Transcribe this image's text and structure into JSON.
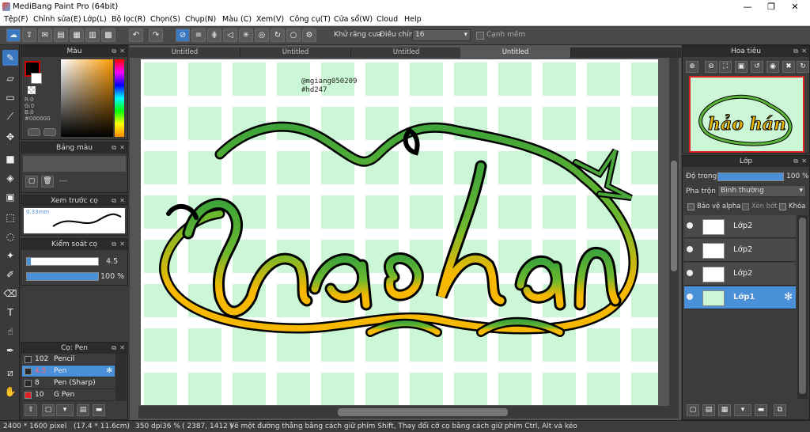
{
  "app": {
    "title": "MediBang Paint Pro (64bit)",
    "min": "—",
    "max": "❐",
    "close": "✕"
  },
  "menu": [
    "Tệp(F)",
    "Chỉnh sửa(E)",
    "Lớp(L)",
    "Bộ lọc(R)",
    "Chọn(S)",
    "Chụp(N)",
    "Màu (C)",
    "Xem(V)",
    "Công cụ(T)",
    "Cửa sổ(W)",
    "Cloud",
    "Help"
  ],
  "toolbar": {
    "antialias_label": "Khử răng cưa",
    "adjust_label": "Điều chỉnh",
    "adjust_value": "16",
    "edge_label": "Cạnh mềm",
    "antialias_checked": "✕"
  },
  "color_panel": {
    "title": "Màu",
    "r": "R:0",
    "g": "G:0",
    "b": "B:0",
    "hex": "#000000",
    "fg": "#000000",
    "accent": "#cc0000"
  },
  "palette_panel": {
    "title": "Bảng màu",
    "value": "---"
  },
  "brush_preview": {
    "title": "Xem trước cọ",
    "size": "0.33mm"
  },
  "brush_control": {
    "title": "Kiểm soát cọ",
    "size_value": "4.5",
    "opacity_value": "100 %"
  },
  "brush_list": {
    "title": "Cọ: Pen",
    "items": [
      {
        "size": "102",
        "name": "Pencil",
        "color": "#2a2a2a",
        "selected": false
      },
      {
        "size": "4.5",
        "name": "Pen",
        "color": "#2a2a2a",
        "selected": true
      },
      {
        "size": "8",
        "name": "Pen (Sharp)",
        "color": "#2a2a2a",
        "selected": false
      },
      {
        "size": "10",
        "name": "G Pen",
        "color": "#dd2222",
        "selected": false
      }
    ]
  },
  "tabs": [
    "Untitled",
    "Untitled",
    "Untitled",
    "Untitled"
  ],
  "artwork": {
    "handle": "@mgiang050209",
    "tag": "#hd247",
    "text": "hảo hán"
  },
  "navigator": {
    "title": "Hoa tiêu"
  },
  "layer_panel": {
    "title": "Lớp",
    "opacity_label": "Độ trong",
    "opacity_value": "100 %",
    "blend_label": "Pha trộn",
    "blend_value": "Bình thường",
    "protect_alpha": "Bảo vệ alpha",
    "clip": "Xén bớt",
    "lock": "Khóa",
    "layers": [
      {
        "name": "Lớp2",
        "selected": false
      },
      {
        "name": "Lớp2",
        "selected": false
      },
      {
        "name": "Lớp2",
        "selected": false
      },
      {
        "name": "Lớp1",
        "selected": true
      }
    ]
  },
  "status": {
    "size": "2400 * 1600 pixel",
    "physical": "(17.4 * 11.6cm)",
    "dpi": "350 dpi",
    "zoom": "36 %",
    "coords": "( 2387, 1412 )",
    "hint": "Vẽ một đường thẳng bằng cách giữ phím Shift, Thay đổi cỡ cọ bằng cách giữ phím Ctrl, Alt và kéo"
  }
}
